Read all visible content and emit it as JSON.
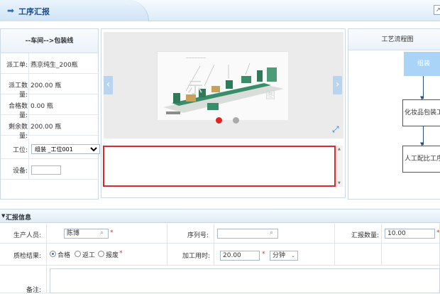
{
  "header": {
    "title": "工序汇报"
  },
  "left": {
    "heading": "--车间-->包装线",
    "rows": [
      {
        "label": "派工单:",
        "value": "燕京纯生_200瓶"
      },
      {
        "label": "派工数量:",
        "value": "200.00 瓶"
      },
      {
        "label": "合格数量:",
        "value": "0.00 瓶"
      },
      {
        "label": "剩余数量:",
        "value": "200.00 瓶"
      }
    ],
    "station_label": "工位:",
    "station_value": "组装 _工位001",
    "device_label": "设备:"
  },
  "center": {
    "watermark_left": "示",
    "watermark_right": "图"
  },
  "flow": {
    "heading": "工艺流程图",
    "steps": [
      "组装",
      "化妆品包装工",
      "人工配比工序"
    ]
  },
  "section": {
    "title": "汇报信息"
  },
  "form": {
    "producer_label": "生产人员:",
    "producer_value": "陈博",
    "serial_label": "序列号:",
    "report_qty_label": "汇报数量:",
    "report_qty_value": "10.00",
    "qc_label": "质检结果:",
    "qc_options": [
      "合格",
      "返工",
      "报废"
    ],
    "process_time_label": "加工用时:",
    "process_time_value": "20.00",
    "time_unit": "分钟",
    "remark_label": "备注:"
  }
}
